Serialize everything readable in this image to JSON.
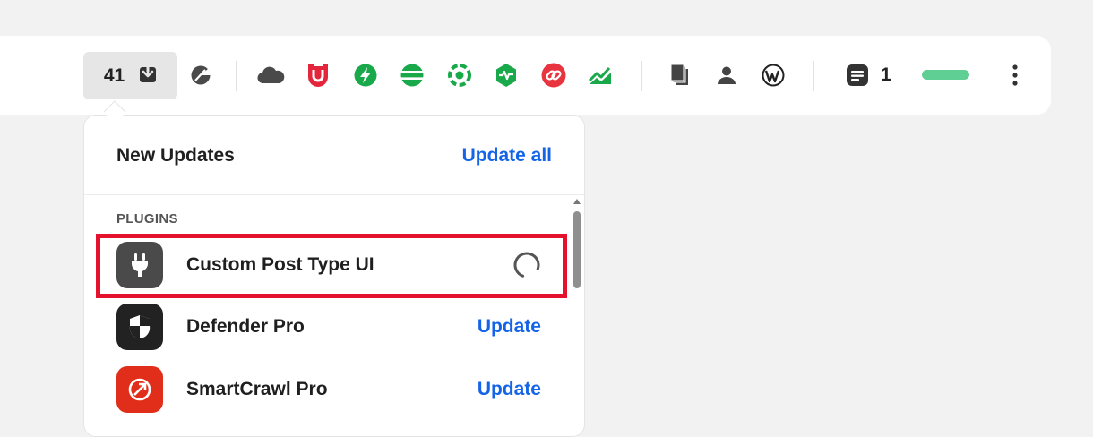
{
  "toolbar": {
    "updates_count": "41",
    "notes_count": "1",
    "progress_fraction": 1.0,
    "icons": [
      "download-icon",
      "tachometer-icon",
      "cloud-icon",
      "shield-u-icon",
      "lightning-icon",
      "layers-icon",
      "target-icon",
      "pulse-icon",
      "link-icon",
      "chart-icon",
      "documents-icon",
      "user-icon",
      "wordpress-icon",
      "notes-icon",
      "more-vertical-icon"
    ],
    "colors": {
      "cloud": "#4a4a4a",
      "shield_u": "#e4263d",
      "lightning": "#19a94a",
      "layers": "#19a94a",
      "target": "#19a94a",
      "pulse": "#19a94a",
      "link": "#e8343f",
      "chart": "#19a94a",
      "progress": "#5fcf93"
    }
  },
  "panel": {
    "title": "New Updates",
    "update_all_label": "Update all",
    "section_label": "PLUGINS",
    "plugins": [
      {
        "name": "Custom Post Type UI",
        "action": "",
        "status": "loading",
        "icon": "plug-icon",
        "icon_bg": "#4a4a4a"
      },
      {
        "name": "Defender Pro",
        "action": "Update",
        "status": "available",
        "icon": "shield-icon",
        "icon_bg": "#222222"
      },
      {
        "name": "SmartCrawl Pro",
        "action": "Update",
        "status": "available",
        "icon": "smartcrawl-icon",
        "icon_bg": "#e02e1a"
      }
    ]
  }
}
